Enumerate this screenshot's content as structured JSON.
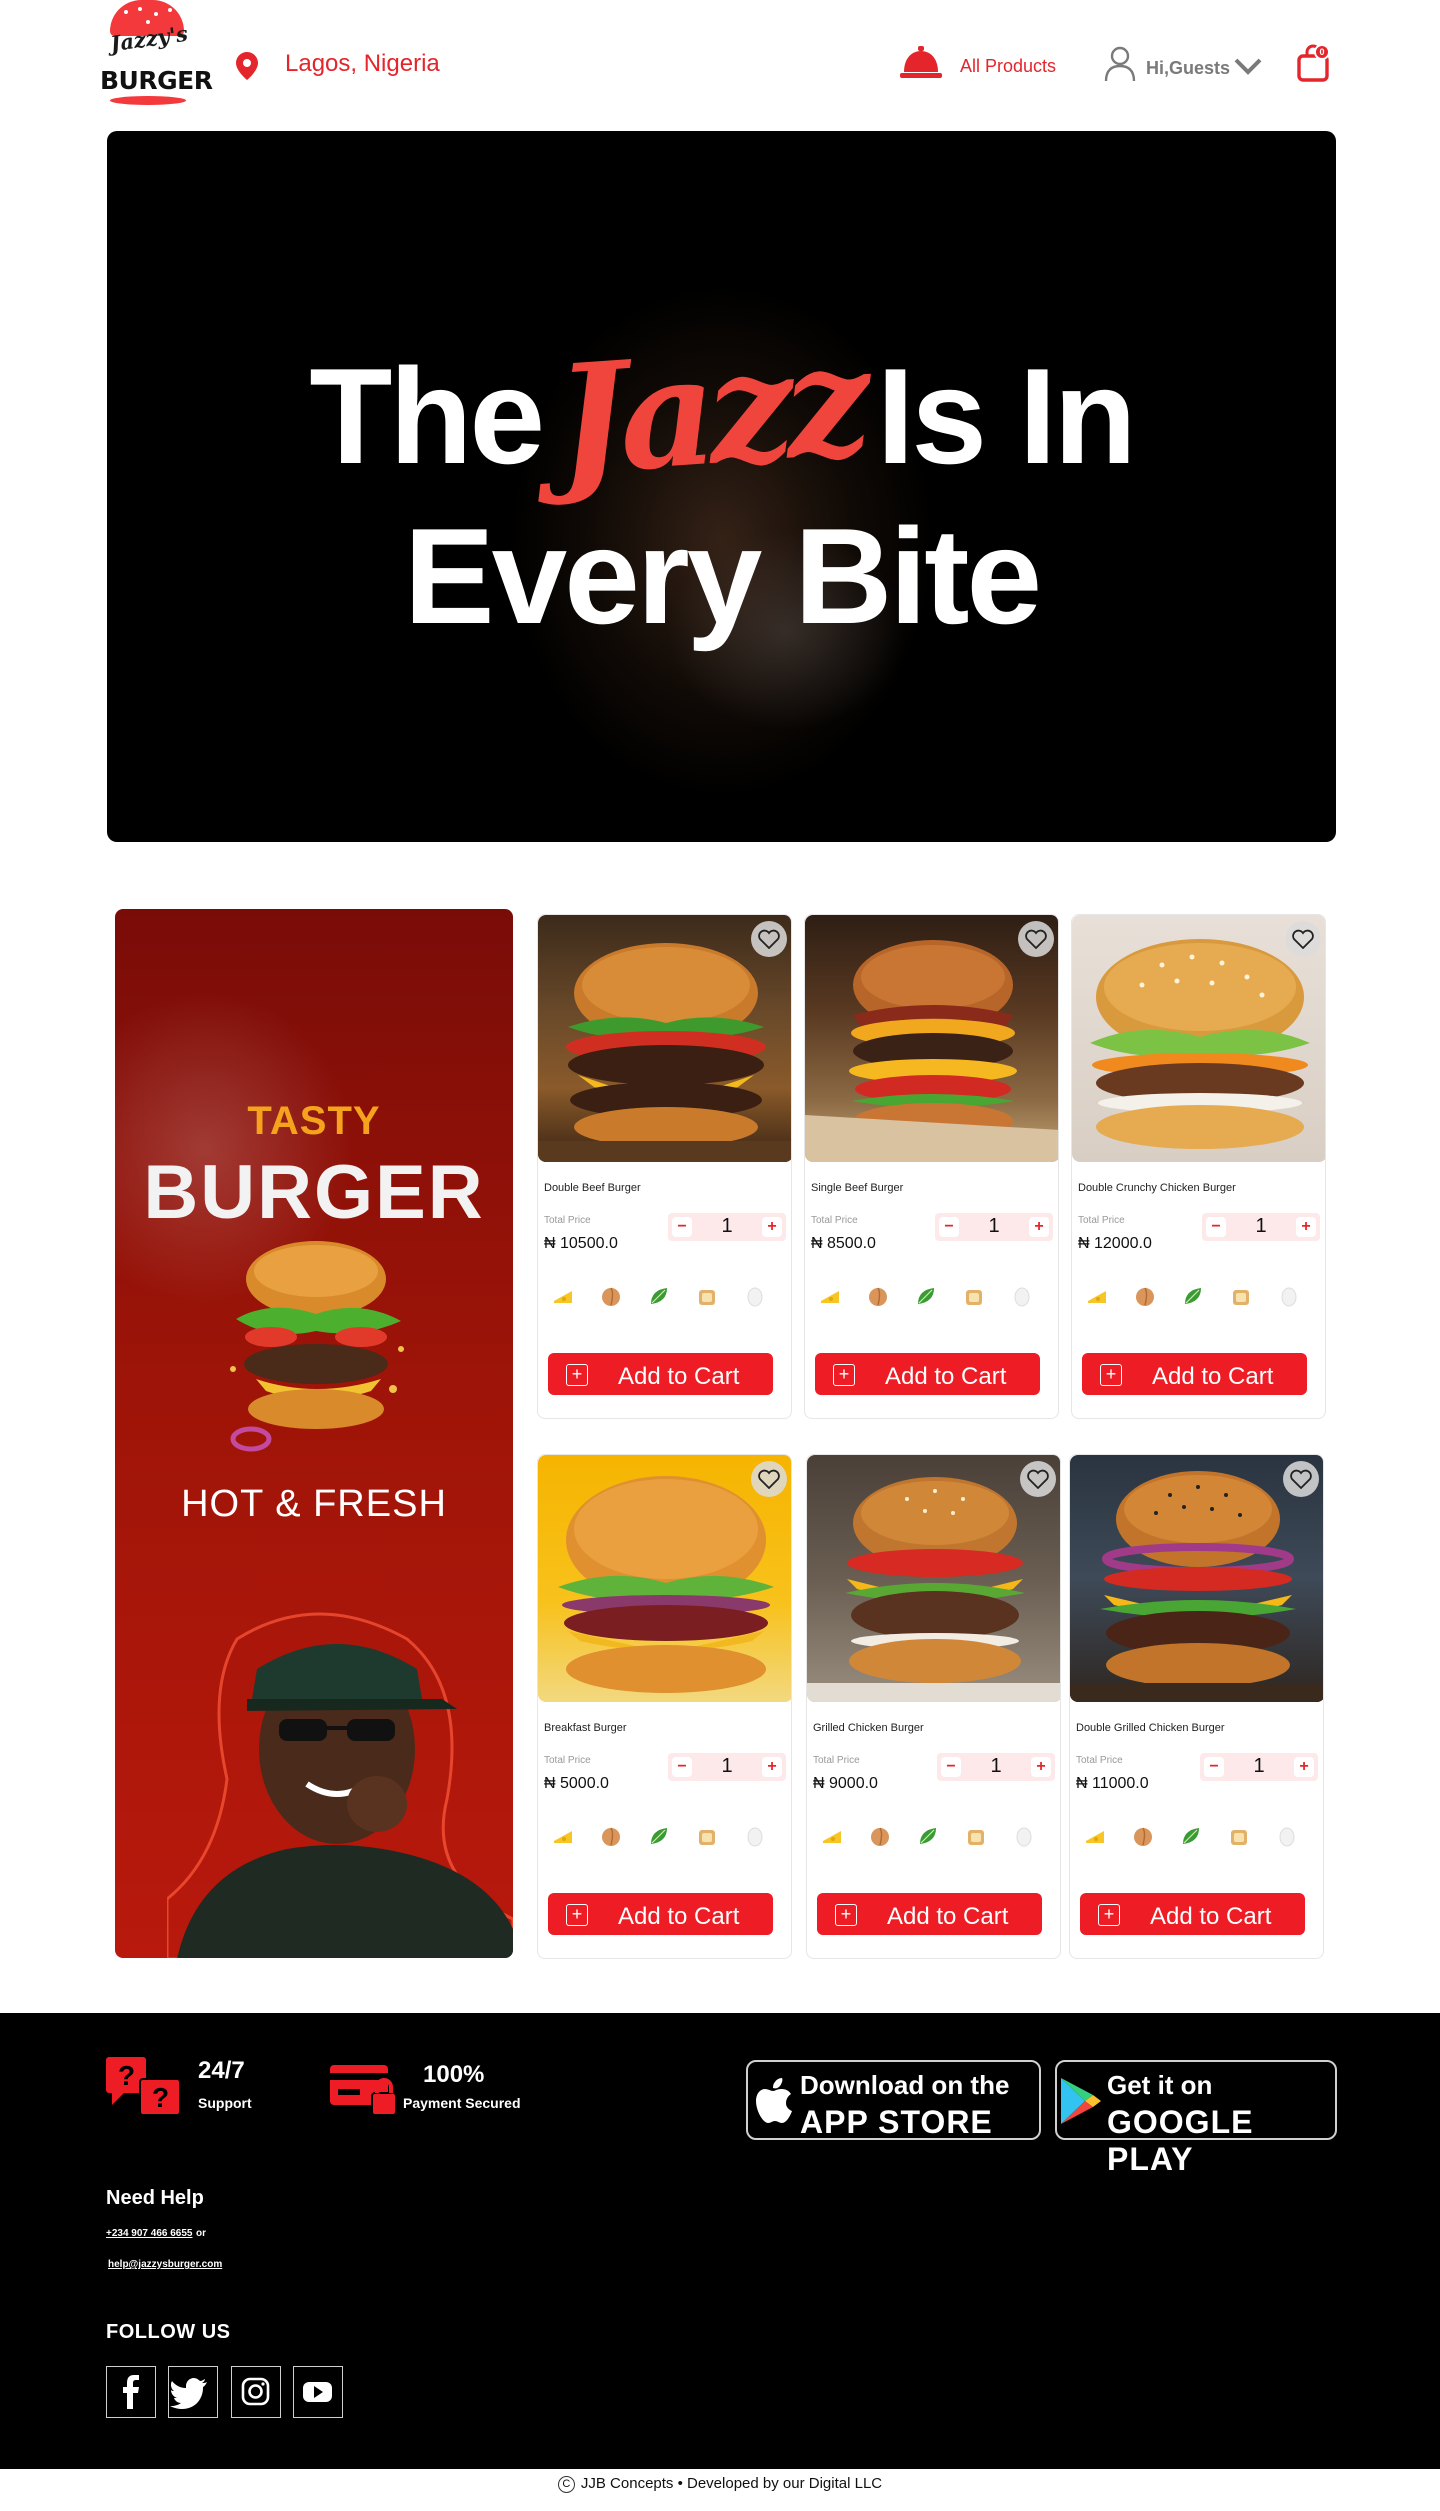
{
  "header": {
    "logo_script": "Jazzy's",
    "logo_word": "BURGER",
    "location": "Lagos, Nigeria",
    "all_products": "All Products",
    "greeting": "Hi,Guests",
    "cart_count": "0"
  },
  "hero": {
    "line1_before": "The",
    "line1_highlight": "Jazz",
    "line1_after": "Is In",
    "line2": "Every Bite"
  },
  "promo": {
    "tasty": "TASTY",
    "burger": "BURGER",
    "hot_fresh": "HOT & FRESH"
  },
  "product_labels": {
    "total_price": "Total Price",
    "add_to_cart": "Add to Cart"
  },
  "products": [
    {
      "name": "Double Beef Burger",
      "price": "₦ 10500.0",
      "qty": "1"
    },
    {
      "name": "Single Beef Burger",
      "price": "₦ 8500.0",
      "qty": "1"
    },
    {
      "name": "Double Crunchy Chicken Burger",
      "price": "₦ 12000.0",
      "qty": "1"
    },
    {
      "name": "Breakfast Burger",
      "price": "₦ 5000.0",
      "qty": "1"
    },
    {
      "name": "Grilled Chicken Burger",
      "price": "₦ 9000.0",
      "qty": "1"
    },
    {
      "name": "Double Grilled Chicken  Burger",
      "price": "₦ 11000.0",
      "qty": "1"
    }
  ],
  "footer": {
    "support_title": "24/7",
    "support_label": "Support",
    "payment_title": "100%",
    "payment_label": "Payment Secured",
    "app_store_line1": "Download on the",
    "app_store_line2": "APP STORE",
    "google_line1": "Get it on",
    "google_line2": "GOOGLE PLAY",
    "need_help": "Need Help",
    "phone": "+234 907 466 6655",
    "or": "or",
    "email": "help@jazzysburger.com",
    "follow_us": "FOLLOW US"
  },
  "copyright": {
    "symbol": "C",
    "text": "JJB Concepts • Developed by our Digital  LLC"
  },
  "colors": {
    "brand_red": "#ee1c24",
    "stepper_bg": "#fde9ea",
    "footer_bg": "#000000"
  }
}
